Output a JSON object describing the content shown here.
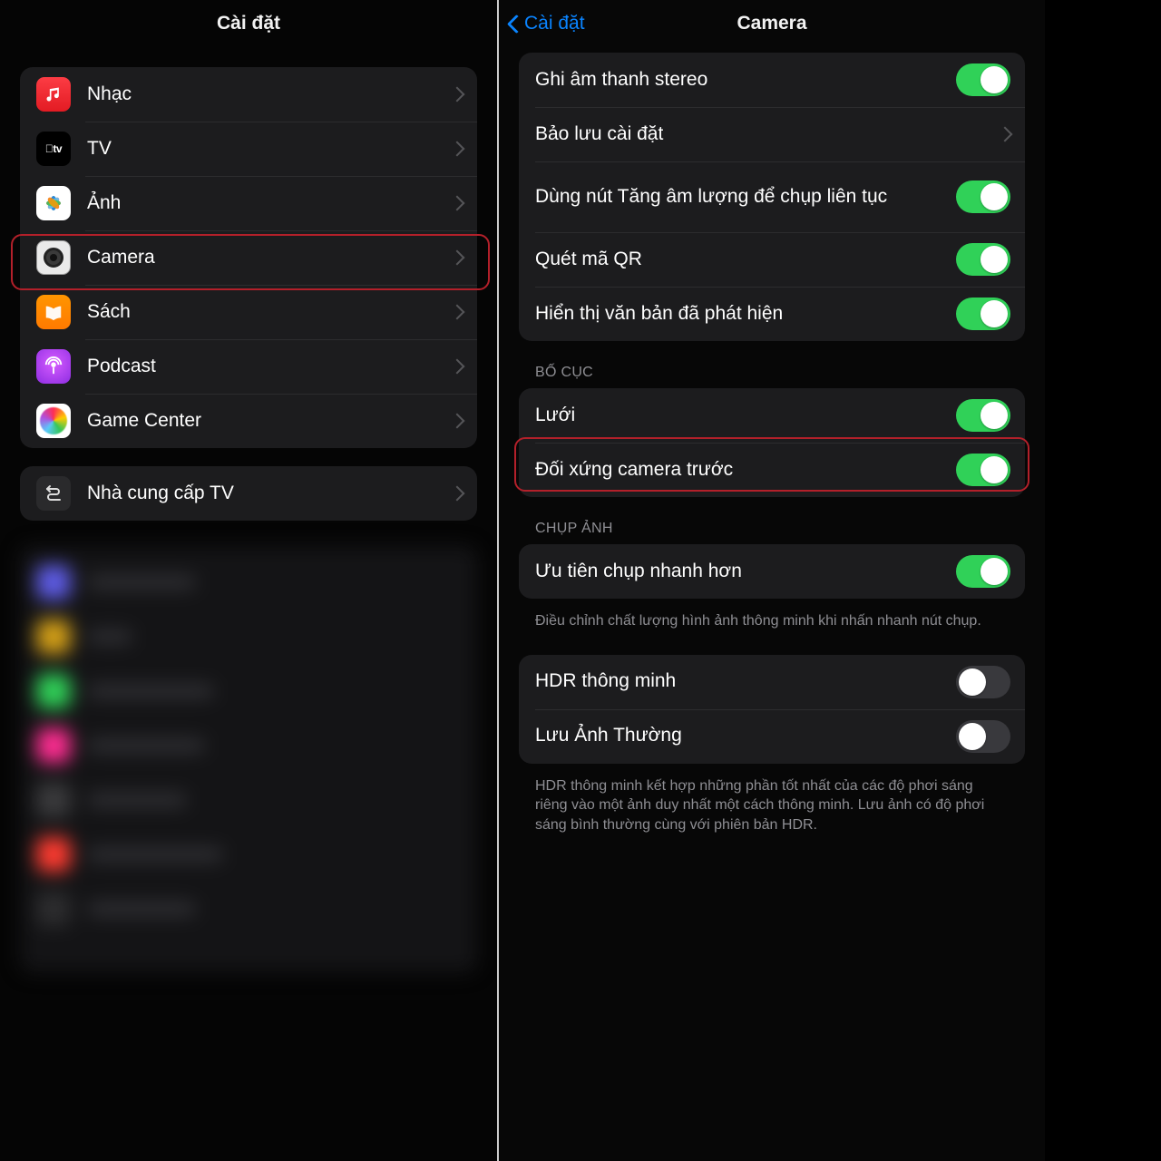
{
  "left": {
    "title": "Cài đặt",
    "items": [
      {
        "key": "music",
        "label": "Nhạc"
      },
      {
        "key": "tv",
        "label": "TV"
      },
      {
        "key": "photos",
        "label": "Ảnh"
      },
      {
        "key": "camera",
        "label": "Camera"
      },
      {
        "key": "books",
        "label": "Sách"
      },
      {
        "key": "podcast",
        "label": "Podcast"
      },
      {
        "key": "gamecenter",
        "label": "Game Center"
      }
    ],
    "tvprovider": {
      "label": "Nhà cung cấp TV"
    }
  },
  "right": {
    "back": "Cài đặt",
    "title": "Camera",
    "group1": [
      {
        "key": "stereo",
        "label": "Ghi âm thanh stereo",
        "type": "toggle",
        "on": true
      },
      {
        "key": "preserve",
        "label": "Bảo lưu cài đặt",
        "type": "nav"
      },
      {
        "key": "burst",
        "label": "Dùng nút Tăng âm lượng để chụp liên tục",
        "type": "toggle",
        "on": true
      },
      {
        "key": "qr",
        "label": "Quét mã QR",
        "type": "toggle",
        "on": true
      },
      {
        "key": "livetext",
        "label": "Hiển thị văn bản đã phát hiện",
        "type": "toggle",
        "on": true
      }
    ],
    "section_layout": "BỐ CỤC",
    "group2": [
      {
        "key": "grid",
        "label": "Lưới",
        "type": "toggle",
        "on": true
      },
      {
        "key": "mirror",
        "label": "Đối xứng camera trước",
        "type": "toggle",
        "on": true
      }
    ],
    "section_capture": "CHỤP ẢNH",
    "group3": [
      {
        "key": "fastshot",
        "label": "Ưu tiên chụp nhanh hơn",
        "type": "toggle",
        "on": true
      }
    ],
    "footer1": "Điều chỉnh chất lượng hình ảnh thông minh khi nhấn nhanh nút chụp.",
    "group4": [
      {
        "key": "smarthdr",
        "label": "HDR thông minh",
        "type": "toggle",
        "on": false
      },
      {
        "key": "keepnormal",
        "label": "Lưu Ảnh Thường",
        "type": "toggle",
        "on": false
      }
    ],
    "footer2": "HDR thông minh kết hợp những phần tốt nhất của các độ phơi sáng riêng vào một ảnh duy nhất một cách thông minh. Lưu ảnh có độ phơi sáng bình thường cùng với phiên bản HDR."
  }
}
